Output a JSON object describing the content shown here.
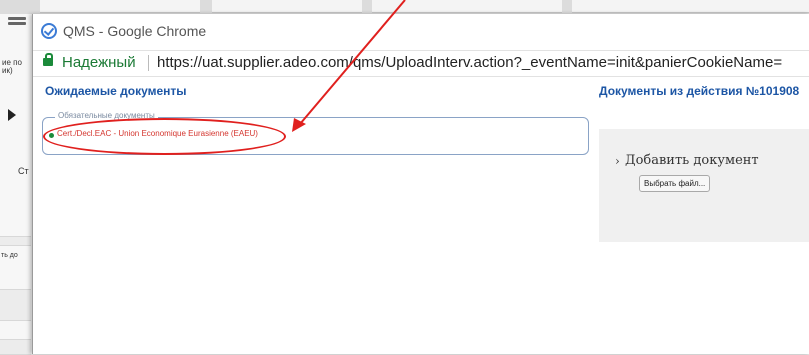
{
  "background": {
    "left_texts": [
      "ие по",
      "ик)",
      "Ст",
      "ть до"
    ]
  },
  "window": {
    "title": "QMS - Google Chrome",
    "security_label": "Надежный",
    "url": "https://uat.supplier.adeo.com/qms/UploadInterv.action?_eventName=init&panierCookieName="
  },
  "content": {
    "expected_docs_heading": "Ожидаемые документы",
    "action_docs_heading": "Документы из действия №101908",
    "mandatory_legend": "Обязательные документы",
    "doc_code": "Cert./Decl.EAC",
    "doc_desc": " - Union Economique Eurasienne (EAEU)",
    "add_document_label": "Добавить документ",
    "choose_file_button": "Выбрать файл..."
  },
  "colors": {
    "heading": "#1d56a5",
    "doc_link": "#d4362f",
    "annotation": "#e0201e",
    "secure": "#1b7a35"
  }
}
